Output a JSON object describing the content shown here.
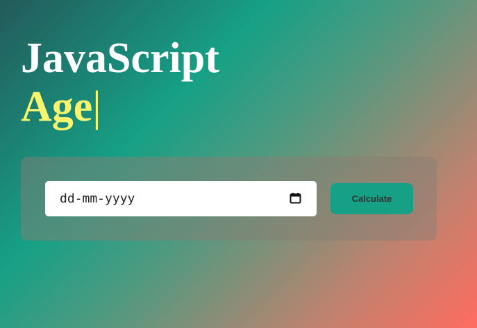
{
  "header": {
    "title": "JavaScript",
    "subtitle": "Age",
    "caret": "|"
  },
  "form": {
    "date_placeholder": "dd-mm-yyyy",
    "calendar_icon": "calendar-icon",
    "calculate_label": "Calculate"
  },
  "colors": {
    "title": "#ffffff",
    "subtitle": "#f7f46d",
    "button": "#16a085",
    "gradient": [
      "#235a5a",
      "#16a085",
      "#4f9a80",
      "#c8806d",
      "#ff6b5f"
    ]
  }
}
